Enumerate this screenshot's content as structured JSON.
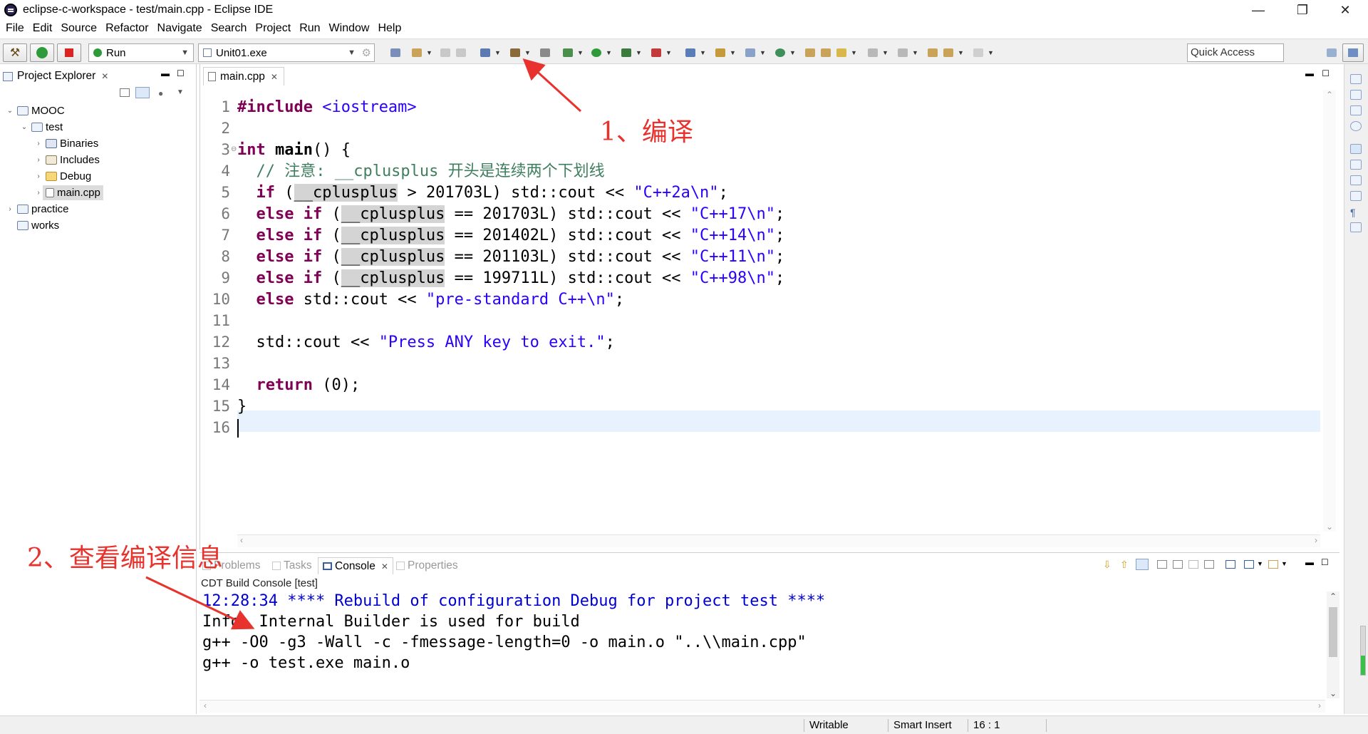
{
  "window": {
    "title": "eclipse-c-workspace - test/main.cpp - Eclipse IDE",
    "minimize": "—",
    "maximize": "❐",
    "close": "✕"
  },
  "menu": [
    "File",
    "Edit",
    "Source",
    "Refactor",
    "Navigate",
    "Search",
    "Project",
    "Run",
    "Window",
    "Help"
  ],
  "toolbar": {
    "launch_mode": "Run",
    "launch_target": "Unit01.exe",
    "quick_access": "Quick Access"
  },
  "project_explorer": {
    "tab_label": "Project Explorer",
    "items": [
      {
        "label": "MOOC",
        "level": 0,
        "expanded": true
      },
      {
        "label": "test",
        "level": 1,
        "expanded": true
      },
      {
        "label": "Binaries",
        "level": 2,
        "expanded": false
      },
      {
        "label": "Includes",
        "level": 2,
        "expanded": false
      },
      {
        "label": "Debug",
        "level": 2,
        "expanded": false
      },
      {
        "label": "main.cpp",
        "level": 2,
        "expanded": false,
        "selected": true
      },
      {
        "label": "practice",
        "level": 0,
        "expanded": false
      },
      {
        "label": "works",
        "level": 0,
        "expanded": false
      }
    ]
  },
  "editor": {
    "tab_label": "main.cpp",
    "line_numbers": [
      "1",
      "2",
      "3",
      "4",
      "5",
      "6",
      "7",
      "8",
      "9",
      "10",
      "11",
      "12",
      "13",
      "14",
      "15",
      "16"
    ],
    "lines": [
      "#include <iostream>",
      "",
      "int main() {",
      "  // 注意: __cplusplus 开头是连续两个下划线",
      "  if (__cplusplus > 201703L) std::cout << \"C++2a\\n\";",
      "  else if (__cplusplus == 201703L) std::cout << \"C++17\\n\";",
      "  else if (__cplusplus == 201402L) std::cout << \"C++14\\n\";",
      "  else if (__cplusplus == 201103L) std::cout << \"C++11\\n\";",
      "  else if (__cplusplus == 199711L) std::cout << \"C++98\\n\";",
      "  else std::cout << \"pre-standard C++\\n\";",
      "",
      "  std::cout << \"Press ANY key to exit.\";",
      "",
      "  return (0);",
      "}",
      ""
    ],
    "cursor_line": 16
  },
  "bottom_tabs": [
    "Problems",
    "Tasks",
    "Console",
    "Properties"
  ],
  "console": {
    "title": "CDT Build Console [test]",
    "lines": [
      "12:28:34 **** Rebuild of configuration Debug for project test ****",
      "Info: Internal Builder is used for build",
      "g++ -O0 -g3 -Wall -c -fmessage-length=0 -o main.o \"..\\\\main.cpp\"",
      "g++ -o test.exe main.o"
    ]
  },
  "status": {
    "writable": "Writable",
    "insert_mode": "Smart Insert",
    "position": "16 : 1"
  },
  "annotations": {
    "compile": "1、编译",
    "view_info": "2、查看编译信息",
    "color": "#e8322d"
  }
}
